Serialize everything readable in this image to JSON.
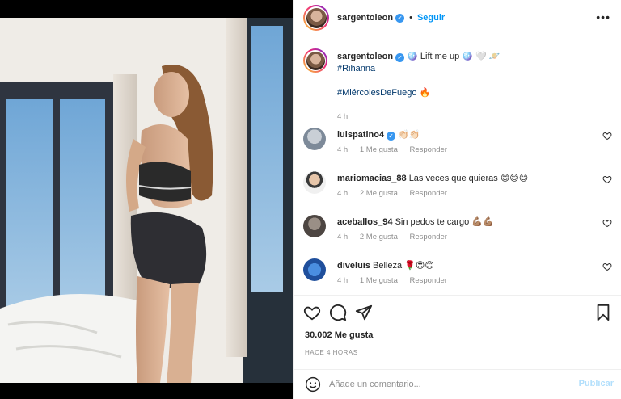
{
  "post": {
    "username": "sargentoleon",
    "follow_label": "Seguir",
    "separator": "•",
    "more_label": "•••",
    "image_alt": "Photo"
  },
  "caption": {
    "username": "sargentoleon",
    "text": "🪩 Lift me up 🪩 🤍 🪐",
    "hashtag1": "#Rihanna",
    "hashtag2": "#MiércolesDeFuego",
    "fire": "🔥",
    "time": "4 h"
  },
  "comments": [
    {
      "username": "luispatino4",
      "verified": true,
      "text": "👏🏻👏🏻",
      "time": "4 h",
      "likes": "1 Me gusta",
      "reply": "Responder"
    },
    {
      "username": "mariomacias_88",
      "verified": false,
      "text": "Las veces que quieras 😊😊😊",
      "time": "4 h",
      "likes": "2 Me gusta",
      "reply": "Responder"
    },
    {
      "username": "aceballos_94",
      "verified": false,
      "text": "Sin pedos te cargo 💪🏽💪🏽",
      "time": "4 h",
      "likes": "2 Me gusta",
      "reply": "Responder"
    },
    {
      "username": "diveluis",
      "verified": false,
      "text": "Belleza 🌹😍😊",
      "time": "4 h",
      "likes": "1 Me gusta",
      "reply": "Responder"
    }
  ],
  "stats": {
    "likes": "30.002 Me gusta",
    "ago": "HACE 4 HORAS"
  },
  "composer": {
    "placeholder": "Añade un comentario...",
    "publish_label": "Publicar"
  },
  "colors": {
    "accent": "#0095f6",
    "verified": "#3897f0",
    "publish_disabled": "#b2dffc",
    "muted": "#8e8e8e"
  }
}
